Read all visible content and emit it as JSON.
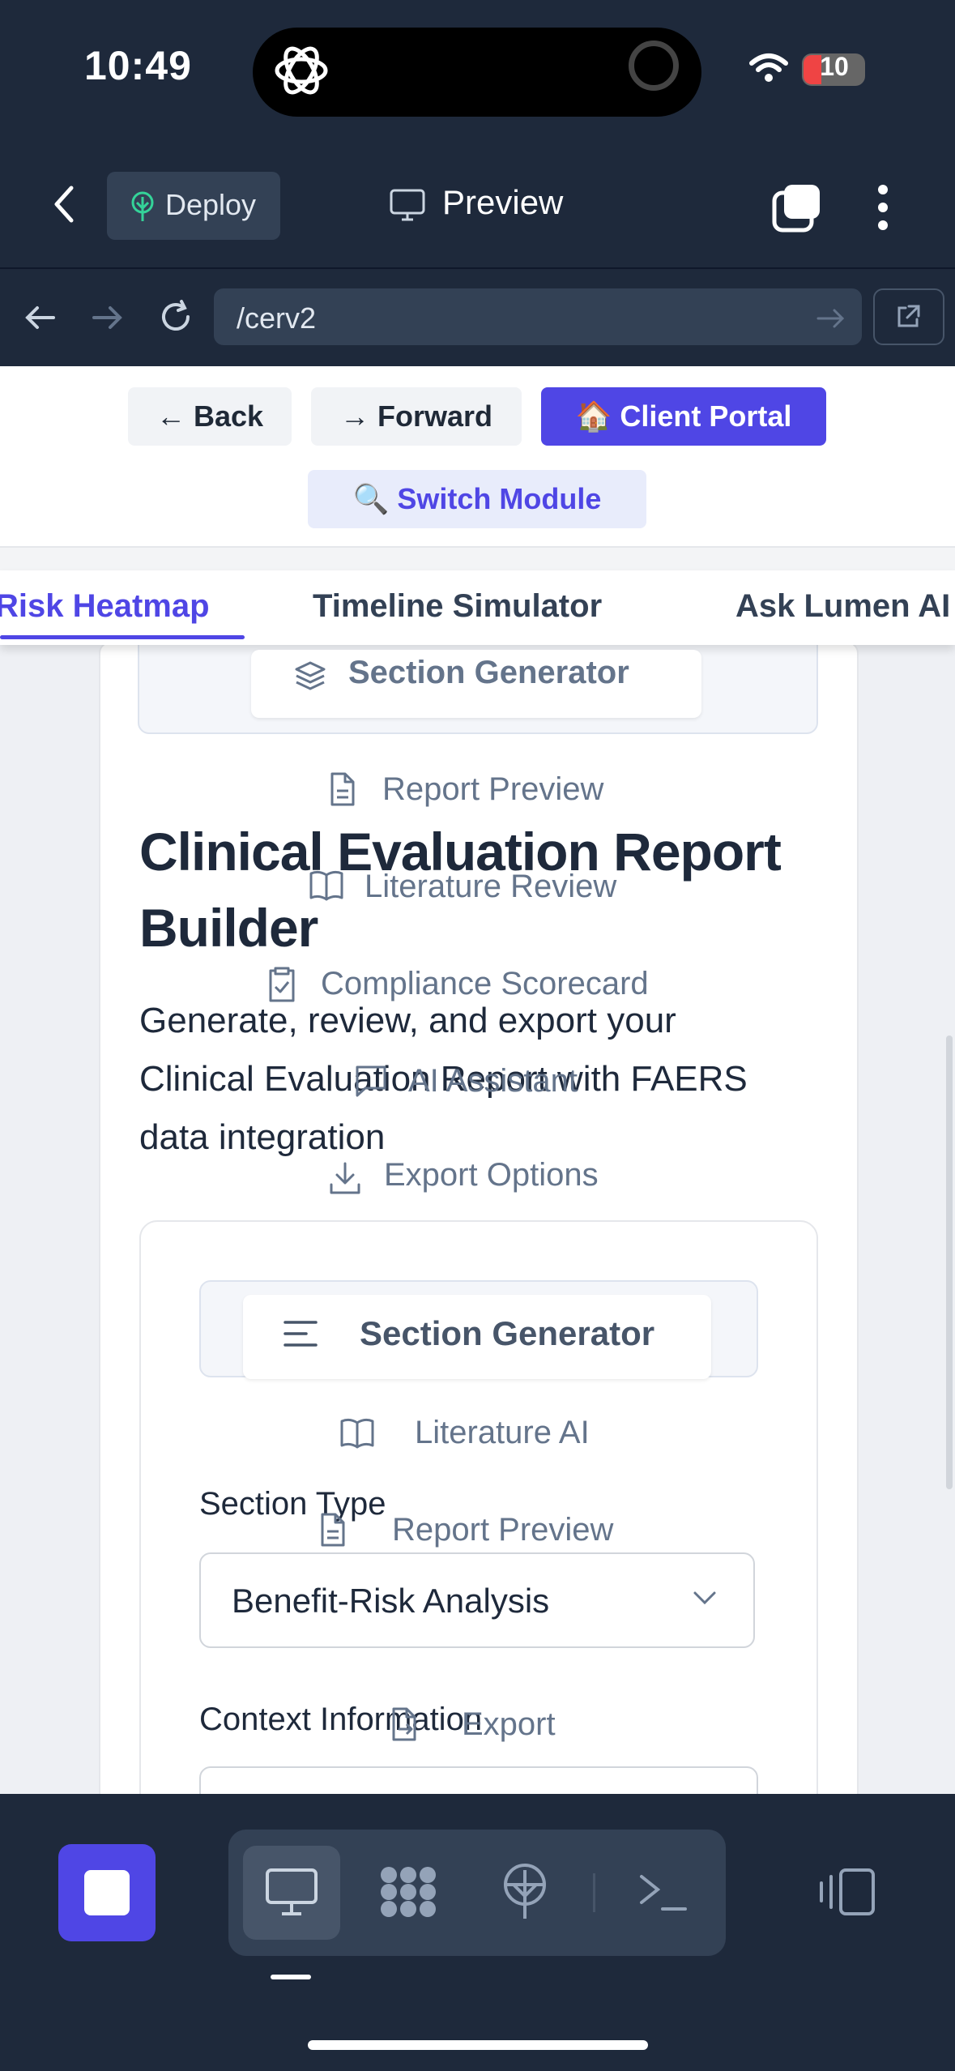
{
  "status_bar": {
    "time": "10:49",
    "battery": "10"
  },
  "toolbar": {
    "deploy_label": "Deploy",
    "preview_label": "Preview"
  },
  "address_bar": {
    "url": "/cerv2"
  },
  "web": {
    "nav_buttons": {
      "back": "← Back",
      "forward": "→ Forward",
      "client_portal": "🏠 Client Portal",
      "switch_module": "🔍 Switch Module"
    },
    "tabs": [
      {
        "label": "Risk Heatmap",
        "active": true
      },
      {
        "label": "Timeline Simulator",
        "active": false
      },
      {
        "label": "Ask Lumen AI",
        "active": false
      }
    ],
    "top_section_menu": [
      {
        "label": "Section Generator",
        "icon": "layers-icon"
      },
      {
        "label": "Report Preview",
        "icon": "file-icon"
      },
      {
        "label": "Literature Review",
        "icon": "book-icon"
      },
      {
        "label": "Compliance Scorecard",
        "icon": "clipboard-check-icon"
      },
      {
        "label": "AI Assistant",
        "icon": "message-icon"
      },
      {
        "label": "Export Options",
        "icon": "download-icon"
      }
    ],
    "page_title": "Clinical Evaluation Report Builder",
    "page_subtitle": "Generate, review, and export your Clinical Evaluation Report with FAERS data integration",
    "inner_menu": [
      {
        "label": "Section Generator",
        "icon": "align-left-icon"
      },
      {
        "label": "Literature AI",
        "icon": "book-icon"
      },
      {
        "label": "Report Preview",
        "icon": "file-icon"
      },
      {
        "label": "Export",
        "icon": "file-export-icon"
      }
    ],
    "form": {
      "section_type_label": "Section Type",
      "section_type_value": "Benefit-Risk Analysis",
      "context_label": "Context Information"
    }
  },
  "colors": {
    "accent": "#4f46e5",
    "dark_chrome": "#1e293b",
    "muted": "#64748b"
  }
}
